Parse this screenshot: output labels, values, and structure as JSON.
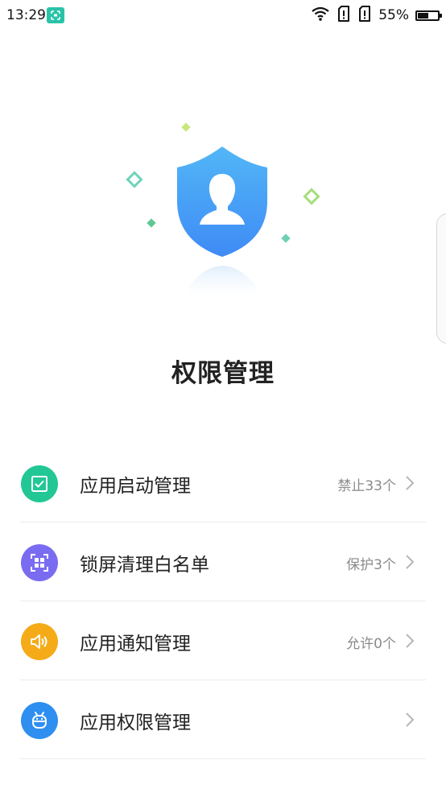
{
  "status_bar": {
    "time": "13:29",
    "battery_percent": "55%",
    "battery_level": 0.55,
    "icons": [
      "screenshot-app-icon",
      "wifi-icon",
      "sim-alert-icon",
      "sim-alert-icon"
    ]
  },
  "page": {
    "title": "权限管理"
  },
  "items": [
    {
      "label": "应用启动管理",
      "status": "禁止33个",
      "icon": "check-square-icon",
      "color": "#22c795"
    },
    {
      "label": "锁屏清理白名单",
      "status": "保护3个",
      "icon": "lock-clean-icon",
      "color": "#7a6cf1"
    },
    {
      "label": "应用通知管理",
      "status": "允许0个",
      "icon": "speaker-icon",
      "color": "#f5ab17"
    },
    {
      "label": "应用权限管理",
      "status": "",
      "icon": "android-icon",
      "color": "#2e8ff0"
    }
  ],
  "colors": {
    "shield_top": "#4fb3f7",
    "shield_bottom": "#3d8df5",
    "accent_green": "#7fd36a",
    "accent_teal": "#5fd0b0"
  }
}
